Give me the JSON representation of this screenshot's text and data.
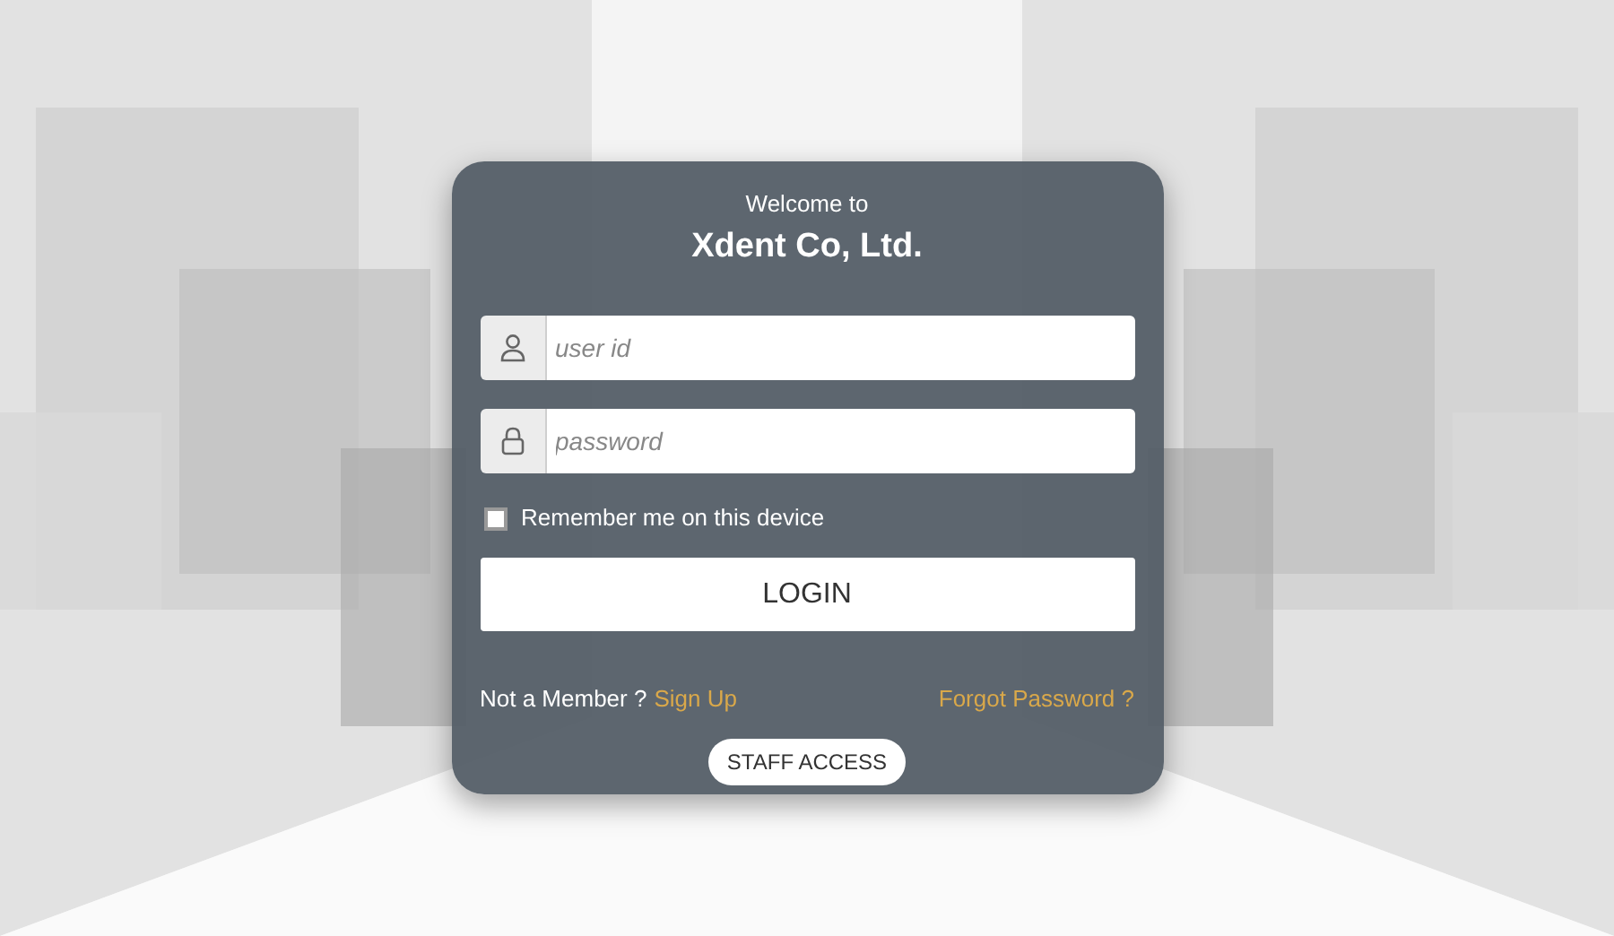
{
  "login_card": {
    "greeting": "Welcome to",
    "company": "Xdent Co, Ltd.",
    "user_field": {
      "placeholder": "user id"
    },
    "password_field": {
      "placeholder": "password"
    },
    "remember": {
      "label": "Remember me on this device",
      "checked": false
    },
    "login_button": "LOGIN",
    "signup_prompt": "Not a Member ?",
    "signup_link": "Sign Up",
    "forgot_link": "Forgot Password ?",
    "staff_button": "STAFF ACCESS"
  }
}
